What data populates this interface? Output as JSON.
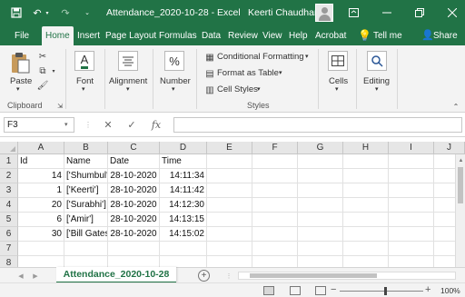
{
  "titlebar": {
    "doc_title": "Attendance_2020-10-28  -  Excel",
    "user_name": "Keerti Chaudhary"
  },
  "ribbon_tabs": [
    {
      "label": "File",
      "active": false
    },
    {
      "label": "Home",
      "active": true
    },
    {
      "label": "Insert",
      "active": false
    },
    {
      "label": "Page Layout",
      "active": false
    },
    {
      "label": "Formulas",
      "active": false
    },
    {
      "label": "Data",
      "active": false
    },
    {
      "label": "Review",
      "active": false
    },
    {
      "label": "View",
      "active": false
    },
    {
      "label": "Help",
      "active": false
    },
    {
      "label": "Acrobat",
      "active": false
    },
    {
      "label": "Tell me",
      "active": false
    },
    {
      "label": "Share",
      "active": false
    }
  ],
  "ribbon": {
    "paste": "Paste",
    "clipboard": "Clipboard",
    "font": "Font",
    "alignment": "Alignment",
    "number": "Number",
    "conditional_formatting": "Conditional Formatting",
    "format_as_table": "Format as Table",
    "cell_styles": "Cell Styles",
    "styles": "Styles",
    "cells": "Cells",
    "editing": "Editing"
  },
  "formula_bar": {
    "name_box": "F3",
    "fx_label": "fx",
    "formula": ""
  },
  "sheet": {
    "columns": [
      "A",
      "B",
      "C",
      "D",
      "E",
      "F",
      "G",
      "H",
      "I",
      "J"
    ],
    "row_numbers": [
      "1",
      "2",
      "3",
      "4",
      "5",
      "6",
      "7",
      "8"
    ],
    "headers": [
      "Id",
      "Name",
      "Date",
      "Time"
    ],
    "rows": [
      [
        "14",
        "['Shumbul']",
        "28-10-2020",
        "14:11:34"
      ],
      [
        "1",
        "['Keerti']",
        "28-10-2020",
        "14:11:42"
      ],
      [
        "20",
        "['Surabhi']",
        "28-10-2020",
        "14:12:30"
      ],
      [
        "6",
        "['Amir']",
        "28-10-2020",
        "14:13:15"
      ],
      [
        "30",
        "['Bill Gates']",
        "28-10-2020",
        "14:15:02"
      ]
    ],
    "active_cell": "F3"
  },
  "sheet_tabs": [
    "Attendance_2020-10-28"
  ],
  "status": {
    "zoom_level": "100%"
  }
}
